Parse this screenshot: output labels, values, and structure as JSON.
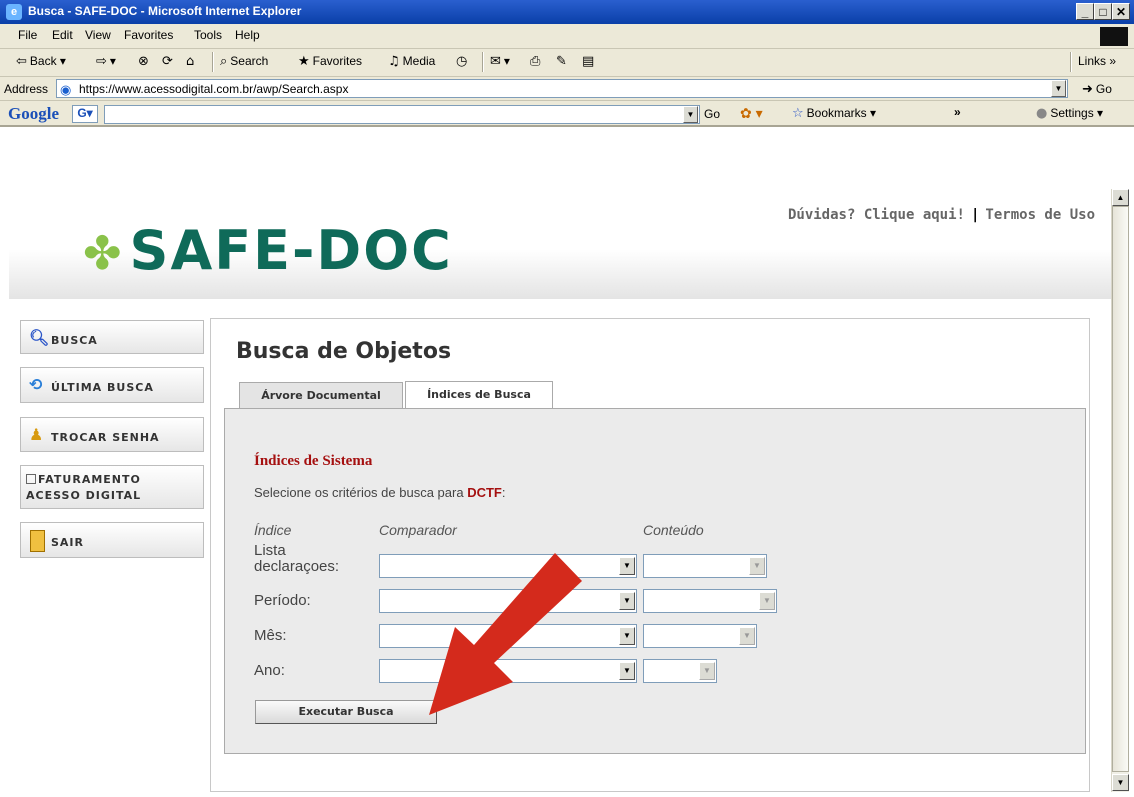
{
  "window": {
    "title": "Busca - SAFE-DOC - Microsoft Internet Explorer"
  },
  "menu": [
    "File",
    "Edit",
    "View",
    "Favorites",
    "Tools",
    "Help"
  ],
  "toolbar": {
    "back": "Back",
    "search": "Search",
    "favorites": "Favorites",
    "media": "Media",
    "links": "Links"
  },
  "address": {
    "label": "Address",
    "url": "https://www.acessodigital.com.br/awp/Search.aspx",
    "go": "Go"
  },
  "google_bar": {
    "logo": "Google",
    "go": "Go",
    "bookmarks": "Bookmarks",
    "settings": "Settings"
  },
  "site": {
    "logo": "SAFE-DOC",
    "help_link": "Dúvidas? Clique aqui!",
    "terms_link": "Termos de Uso",
    "nav": [
      {
        "label": "BUSCA",
        "icon": "magnifier-icon"
      },
      {
        "label": "ÚLTIMA BUSCA",
        "icon": "refresh-search-icon"
      },
      {
        "label": "TROCAR SENHA",
        "icon": "user-icon"
      },
      {
        "label": "FATURAMENTO",
        "label2": "ACESSO DIGITAL",
        "icon": "document-icon"
      },
      {
        "label": "SAIR",
        "icon": "exit-door-icon"
      }
    ]
  },
  "main": {
    "heading": "Busca de Objetos",
    "tabs": [
      "Árvore Documental",
      "Índices de Busca"
    ],
    "active_tab": "Índices de Busca",
    "section_title": "Índices de Sistema",
    "instruction_prefix": "Selecione os critérios de busca para ",
    "instruction_target": "DCTF",
    "instruction_suffix": ":",
    "columns": {
      "index": "Índice",
      "comparator": "Comparador",
      "content": "Conteúdo"
    },
    "rows": [
      {
        "label_line1": "Lista",
        "label_line2": "declaraçoes:"
      },
      {
        "label_line1": "Período:"
      },
      {
        "label_line1": "Mês:"
      },
      {
        "label_line1": "Ano:"
      }
    ],
    "execute_button": "Executar Busca"
  },
  "annotation": {
    "color": "#d42a1c"
  }
}
